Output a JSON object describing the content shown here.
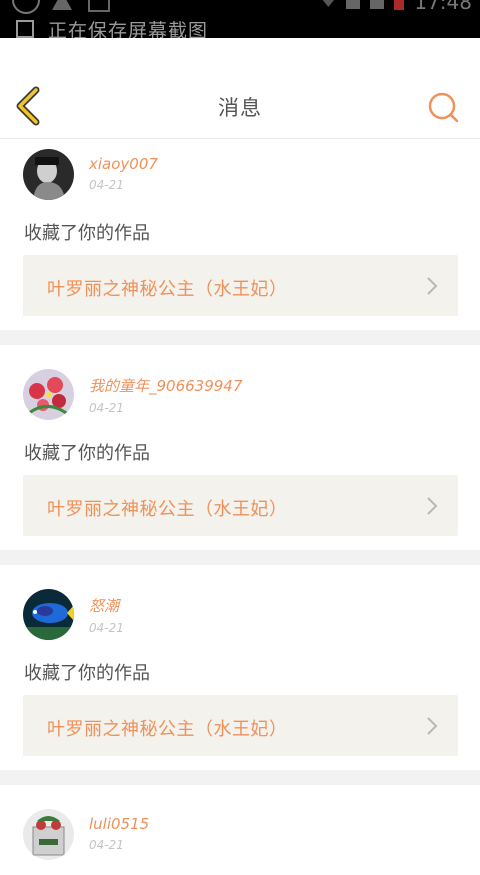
{
  "status_bar": {
    "notification": "正在保存屏幕截图",
    "time": "17:48"
  },
  "header": {
    "title": "消息"
  },
  "colors": {
    "accent": "#f0915a",
    "back_arrow": "#f2c62a",
    "card_bg": "#f3f2ec",
    "gap_bg": "#f2f2f2"
  },
  "messages": [
    {
      "user": "xiaoy007",
      "date": "04-21",
      "action": "收藏了你的作品",
      "work_title": "叶罗丽之神秘公主（水王妃）"
    },
    {
      "user": "我的童年_906639947",
      "date": "04-21",
      "action": "收藏了你的作品",
      "work_title": "叶罗丽之神秘公主（水王妃）"
    },
    {
      "user": "怒潮",
      "date": "04-21",
      "action": "收藏了你的作品",
      "work_title": "叶罗丽之神秘公主（水王妃）"
    },
    {
      "user": "luli0515",
      "date": "04-21"
    }
  ]
}
